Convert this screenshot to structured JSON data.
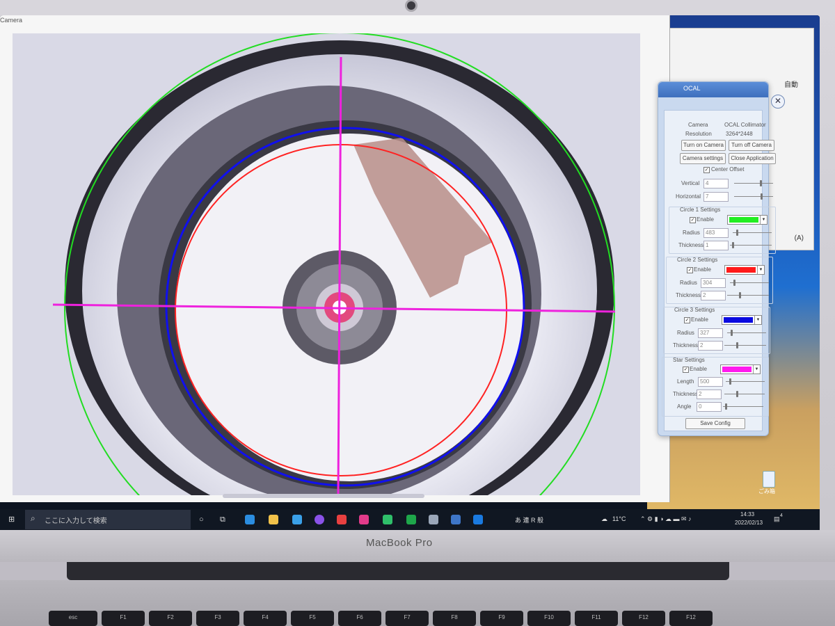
{
  "camera_window": {
    "title": "Camera"
  },
  "overlay": {
    "circle1_color": "#22dd22",
    "circle2_color": "#ff2222",
    "circle3_color": "#1010ee",
    "star_color": "#ee22dd"
  },
  "ocal": {
    "title": "OCAL",
    "close_glyph": "✕",
    "camera_label": "Camera",
    "camera_value": "OCAL Collimator",
    "resolution_label": "Resolution",
    "resolution_value": "3264*2448",
    "turn_on_camera": "Turn on Camera",
    "turn_off_camera": "Turn off Camera",
    "camera_settings": "Camera settings",
    "close_application": "Close Application",
    "center_offset_label": "Center Offset",
    "center_offset_checked": true,
    "vertical_label": "Vertical",
    "vertical_value": "4",
    "vertical_level": 0.7,
    "horizontal_label": "Horizontal",
    "horizontal_value": "7",
    "horizontal_level": 0.72,
    "circle1": {
      "title": "Circle 1 Settings",
      "enable_label": "Enable",
      "enabled": true,
      "color": "#22ee22",
      "radius_label": "Radius",
      "radius": "483",
      "radius_level": 0.1,
      "thickness_label": "Thickness",
      "thickness": "1",
      "thickness_level": 0.05
    },
    "circle2": {
      "title": "Circle 2 Settings",
      "enable_label": "Enable",
      "enabled": true,
      "color": "#ff1a1a",
      "radius_label": "Radius",
      "radius": "304",
      "radius_level": 0.1,
      "thickness_label": "Thickness",
      "thickness": "2",
      "thickness_level": 0.3
    },
    "circle3": {
      "title": "Circle 3 Settings",
      "enable_label": "Enable",
      "enabled": true,
      "color": "#0a0ae0",
      "radius_label": "Radius",
      "radius": "327",
      "radius_level": 0.1,
      "thickness_label": "Thickness",
      "thickness": "2",
      "thickness_level": 0.3
    },
    "star": {
      "title": "Star Settings",
      "enable_label": "Enable",
      "enabled": true,
      "color": "#ff1aee",
      "length_label": "Length",
      "length": "500",
      "length_level": 0.1,
      "thickness_label": "Thickness",
      "thickness": "2",
      "thickness_level": 0.3,
      "angle_label": "Angle",
      "angle": "0",
      "angle_level": 0.05
    },
    "save_config": "Save Config"
  },
  "back_window": {
    "label_top": "自動",
    "label_bottom": "(A)"
  },
  "desktop": {
    "recycle_bin_label": "ごみ箱"
  },
  "taskbar": {
    "search_placeholder": "ここに入力して検索",
    "weather": "11°C",
    "ime_text": "あ 連 R 般",
    "time": "14:33",
    "date": "2022/02/13",
    "notification_count": "4"
  },
  "laptop": {
    "brand": "MacBook Pro"
  },
  "keyboard": [
    "esc",
    "F1",
    "F2",
    "F3",
    "F4",
    "F5",
    "F6",
    "F7",
    "F8",
    "F9",
    "F10",
    "F11",
    "F12",
    "F12"
  ]
}
